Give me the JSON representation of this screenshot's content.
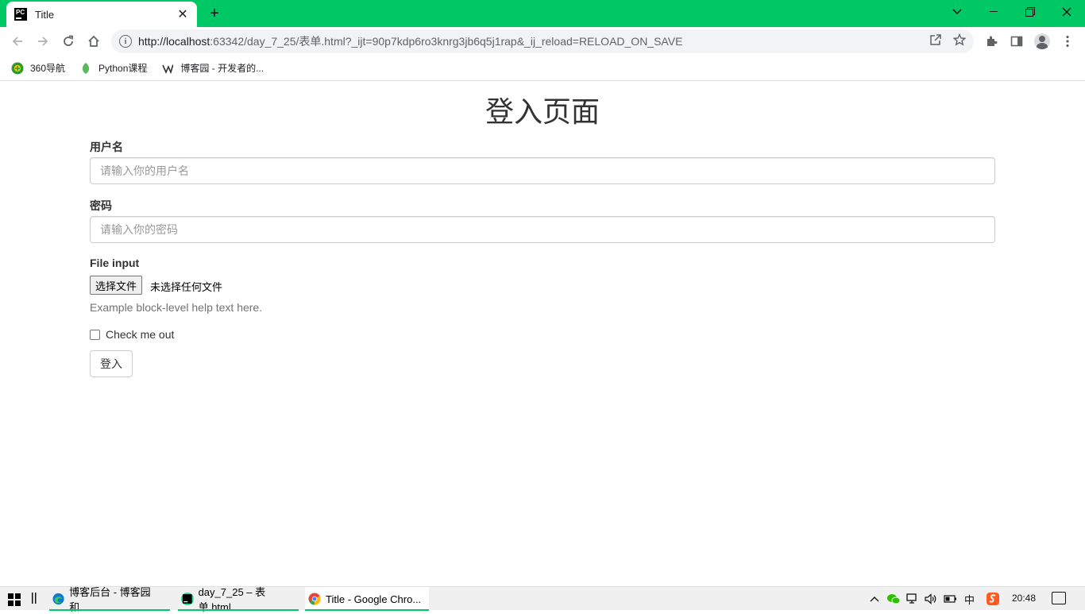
{
  "browser": {
    "tab_title": "Title",
    "tab_close": "✕",
    "new_tab": "+",
    "url_host": "http://localhost",
    "url_rest": ":63342/day_7_25/表单.html?_ijt=90p7kdp6ro3knrg3jb6q5j1rap&_ij_reload=RELOAD_ON_SAVE",
    "bookmarks": [
      {
        "label": "360导航",
        "color": "#2d9c2d"
      },
      {
        "label": "Python课程",
        "color": "#5cb85c"
      },
      {
        "label": "博客园 - 开发者的...",
        "color": "#333333"
      }
    ],
    "accent": "#00c864"
  },
  "page": {
    "title": "登入页面",
    "username_label": "用户名",
    "username_placeholder": "请输入你的用户名",
    "password_label": "密码",
    "password_placeholder": "请输入你的密码",
    "file_label": "File input",
    "file_button": "选择文件",
    "file_status": "未选择任何文件",
    "help_text": "Example block-level help text here.",
    "checkbox_label": "Check me out",
    "submit_label": "登入"
  },
  "taskbar": {
    "tasks": [
      {
        "label": "博客后台 - 博客园 和...",
        "icon_color": "#0c7bd6"
      },
      {
        "label": "day_7_25 – 表单.html",
        "icon_color": "#21d789"
      },
      {
        "label": "Title - Google Chro...",
        "icon_color": "#ea4335"
      }
    ],
    "ime": "中",
    "clock": "20:48"
  }
}
